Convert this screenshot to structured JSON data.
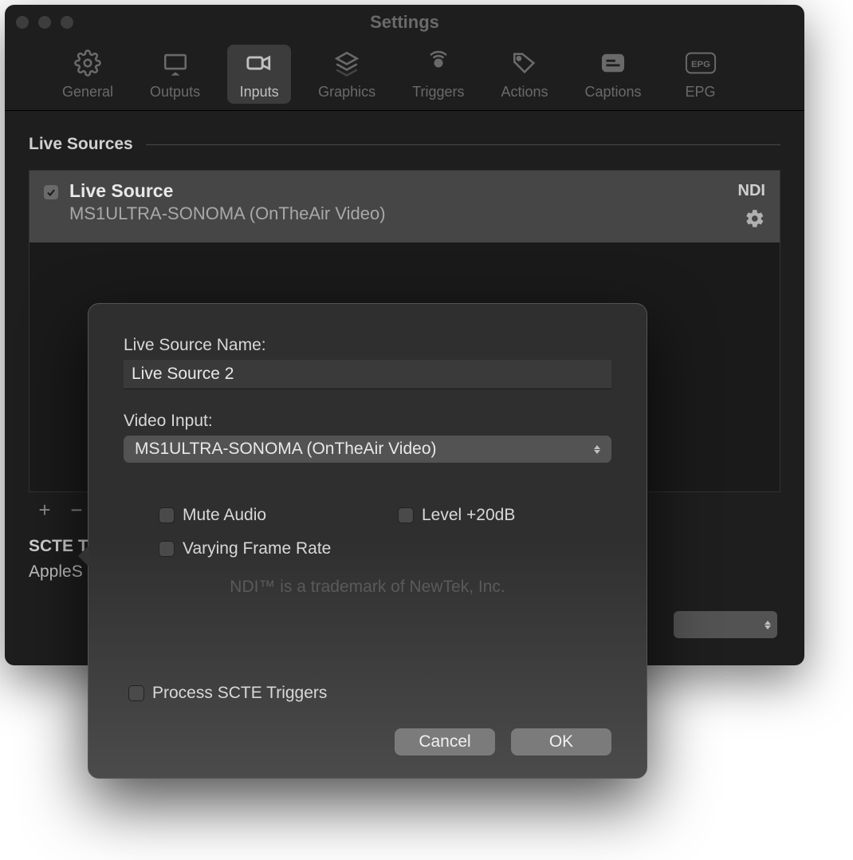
{
  "window": {
    "title": "Settings"
  },
  "toolbar": {
    "items": [
      {
        "label": "General"
      },
      {
        "label": "Outputs"
      },
      {
        "label": "Inputs"
      },
      {
        "label": "Graphics"
      },
      {
        "label": "Triggers"
      },
      {
        "label": "Actions"
      },
      {
        "label": "Captions"
      },
      {
        "label": "EPG"
      }
    ],
    "selected_index": 2
  },
  "sections": {
    "live_sources": {
      "title": "Live Sources",
      "items": [
        {
          "checked": true,
          "name": "Live Source",
          "detail": "MS1ULTRA-SONOMA (OnTheAir Video)",
          "badge": "NDI"
        }
      ]
    },
    "scte": {
      "title_visible": "SCTE T",
      "value_visible": "AppleS"
    }
  },
  "popover": {
    "name_label": "Live Source Name:",
    "name_value": "Live Source 2",
    "video_input_label": "Video Input:",
    "video_input_value": "MS1ULTRA-SONOMA (OnTheAir Video)",
    "mute_audio": {
      "label": "Mute Audio",
      "checked": false
    },
    "level20": {
      "label": "Level +20dB",
      "checked": false
    },
    "varying_frame_rate": {
      "label": "Varying Frame Rate",
      "checked": false
    },
    "trademark": "NDI™ is a trademark of NewTek, Inc.",
    "process_scte": {
      "label": "Process SCTE Triggers",
      "checked": false
    },
    "cancel": "Cancel",
    "ok": "OK"
  }
}
